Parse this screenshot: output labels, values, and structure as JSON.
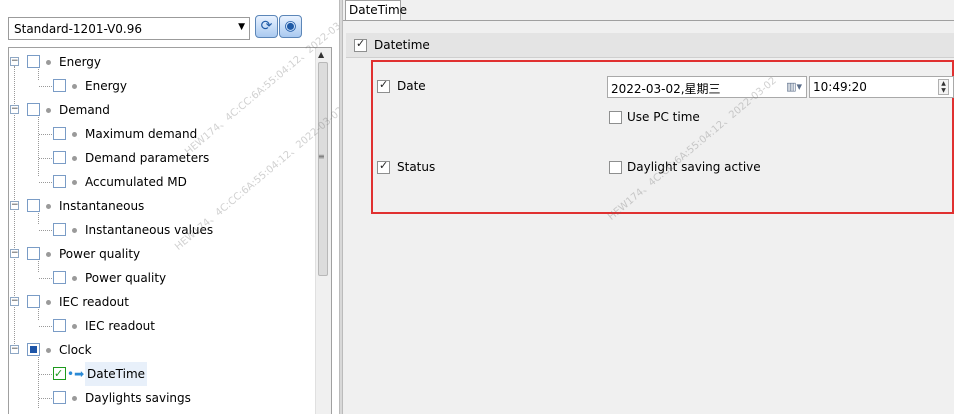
{
  "profile": {
    "value": "Standard-1201-V0.96"
  },
  "toolbar": {
    "refresh_icon": "refresh-icon",
    "connect_icon": "connect-icon"
  },
  "tree": {
    "nodes": [
      {
        "label": "Energy"
      },
      {
        "label": "Energy"
      },
      {
        "label": "Demand"
      },
      {
        "label": "Maximum demand"
      },
      {
        "label": "Demand parameters"
      },
      {
        "label": "Accumulated MD"
      },
      {
        "label": "Instantaneous"
      },
      {
        "label": "Instantaneous values"
      },
      {
        "label": "Power quality"
      },
      {
        "label": "Power quality"
      },
      {
        "label": "IEC readout"
      },
      {
        "label": "IEC readout"
      },
      {
        "label": "Clock"
      },
      {
        "label": "DateTime"
      },
      {
        "label": "Daylights savings"
      }
    ]
  },
  "tab": {
    "label": "DateTime"
  },
  "group": {
    "label": "Datetime"
  },
  "form": {
    "date_label": "Date",
    "date_value": "2022-03-02,星期三",
    "time_value": "10:49:20",
    "use_pc_time": "Use PC time",
    "status_label": "Status",
    "daylight": "Daylight saving active"
  },
  "watermarks": {
    "left_1": "HEW174、4C:CC:6A:55:04:12、2022-03-02",
    "left_2": "HEW174、4C:CC:6A:55:04:12、2022-03-02",
    "right_1": "HEW174、4C:CC:6A:55:04:12、2022-03-02"
  }
}
